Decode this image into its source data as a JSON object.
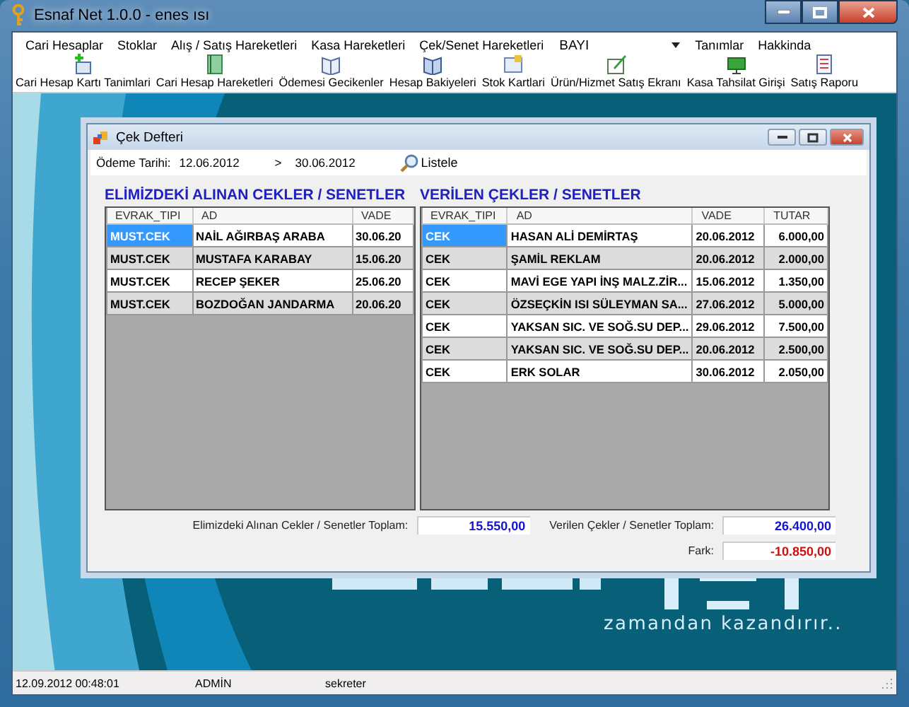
{
  "window": {
    "title": "Esnaf Net 1.0.0 - enes ısı"
  },
  "menu": [
    {
      "kind": "menu",
      "label": "Cari Hesaplar"
    },
    {
      "kind": "menu",
      "label": "Stoklar"
    },
    {
      "kind": "menu",
      "label": "Alış / Satış Hareketleri"
    },
    {
      "kind": "menu",
      "label": "Kasa Hareketleri"
    },
    {
      "kind": "menu",
      "label": "Çek/Senet Hareketleri"
    },
    {
      "kind": "combo",
      "label": "BAYI"
    },
    {
      "kind": "menu",
      "label": "Tanımlar"
    },
    {
      "kind": "menu",
      "label": "Hakkinda"
    }
  ],
  "toolbar": [
    {
      "label": "Cari Hesap Kartı Tanimlari"
    },
    {
      "label": "Cari Hesap Hareketleri"
    },
    {
      "label": "Ödemesi Gecikenler"
    },
    {
      "label": "Hesap Bakiyeleri"
    },
    {
      "label": "Stok Kartlari"
    },
    {
      "label": "Ürün/Hizmet Satış Ekranı"
    },
    {
      "label": "Kasa Tahsilat Girişi"
    },
    {
      "label": "Satış Raporu"
    }
  ],
  "background": {
    "tagline": "zamandan kazandırır.."
  },
  "child_window": {
    "title": "Çek Defteri",
    "filter": {
      "label": "Ödeme Tarihi:",
      "from": "12.06.2012",
      "separator": ">",
      "to": "30.06.2012",
      "button": "Listele"
    },
    "left_panel": {
      "heading": "ELİMİZDEKİ ALINAN CEKLER / SENETLER",
      "columns": [
        "EVRAK_TIPI",
        "AD",
        "VADE"
      ],
      "rows": [
        {
          "selected": true,
          "cells": [
            "MUST.CEK",
            "NAİL AĞIRBAŞ ARABA",
            "30.06.20"
          ]
        },
        {
          "selected": false,
          "cells": [
            "MUST.CEK",
            "MUSTAFA KARABAY",
            "15.06.20"
          ]
        },
        {
          "selected": false,
          "cells": [
            "MUST.CEK",
            "RECEP ŞEKER",
            "25.06.20"
          ]
        },
        {
          "selected": false,
          "cells": [
            "MUST.CEK",
            "BOZDOĞAN JANDARMA",
            "20.06.20"
          ]
        }
      ]
    },
    "right_panel": {
      "heading": "VERİLEN ÇEKLER / SENETLER",
      "columns": [
        "EVRAK_TIPI",
        "AD",
        "VADE",
        "TUTAR"
      ],
      "rows": [
        {
          "selected": true,
          "cells": [
            "CEK",
            "HASAN ALİ DEMİRTAŞ",
            "20.06.2012",
            "6.000,00"
          ]
        },
        {
          "selected": false,
          "cells": [
            "CEK",
            "ŞAMİL REKLAM",
            "20.06.2012",
            "2.000,00"
          ]
        },
        {
          "selected": false,
          "cells": [
            "CEK",
            "MAVİ EGE YAPI İNŞ MALZ.ZİR...",
            "15.06.2012",
            "1.350,00"
          ]
        },
        {
          "selected": false,
          "cells": [
            "CEK",
            "ÖZSEÇKİN ISI SÜLEYMAN SA...",
            "27.06.2012",
            "5.000,00"
          ]
        },
        {
          "selected": false,
          "cells": [
            "CEK",
            "YAKSAN SIC. VE SOĞ.SU DEP...",
            "29.06.2012",
            "7.500,00"
          ]
        },
        {
          "selected": false,
          "cells": [
            "CEK",
            "YAKSAN SIC. VE SOĞ.SU DEP...",
            "20.06.2012",
            "2.500,00"
          ]
        },
        {
          "selected": false,
          "cells": [
            "CEK",
            "ERK SOLAR",
            "30.06.2012",
            "2.050,00"
          ]
        }
      ]
    },
    "totals": [
      {
        "label": "Elimizdeki Alınan Cekler / Senetler Toplam:",
        "value": "15.550,00",
        "color": "#1414c8"
      },
      {
        "label": "Verilen Çekler / Senetler Toplam:",
        "value": "26.400,00",
        "color": "#1414c8"
      },
      {
        "label": "Fark:",
        "value": "-10.850,00",
        "color": "#d01010"
      }
    ]
  },
  "status_bar": [
    "12.09.2012 00:48:01",
    "ADMİN",
    "sekreter"
  ]
}
